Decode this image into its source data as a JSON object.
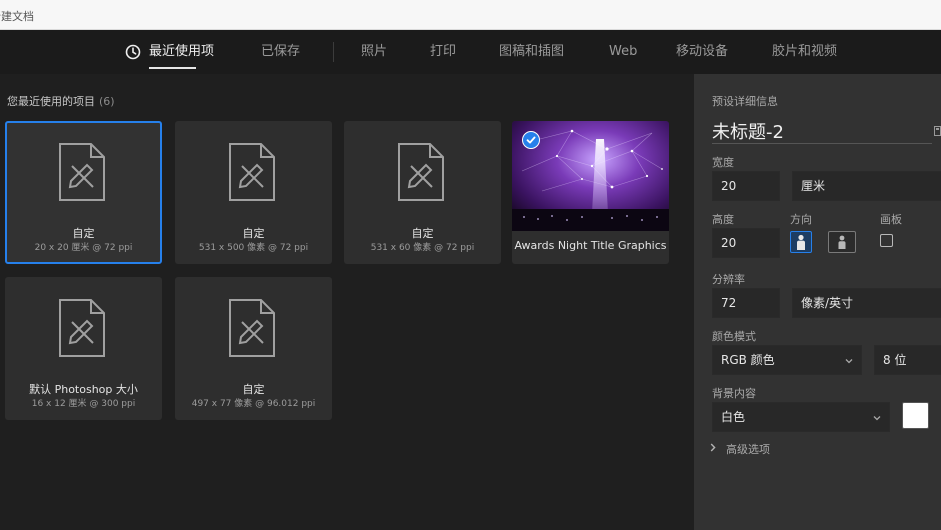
{
  "window": {
    "title": "新建文档"
  },
  "tabs": [
    {
      "label": "最近使用项",
      "active": true,
      "icon": "clock-icon"
    },
    {
      "label": "已保存"
    },
    {
      "label": "照片"
    },
    {
      "label": "打印"
    },
    {
      "label": "图稿和插图"
    },
    {
      "label": "Web"
    },
    {
      "label": "移动设备"
    },
    {
      "label": "胶片和视频"
    }
  ],
  "recent": {
    "title": "您最近使用的项目",
    "count": "(6)",
    "items": [
      {
        "label": "自定",
        "detail": "20 x 20 厘米 @ 72 ppi",
        "selected": true
      },
      {
        "label": "自定",
        "detail": "531 x 500 像素 @ 72 ppi"
      },
      {
        "label": "自定",
        "detail": "531 x 60 像素 @ 72 ppi"
      },
      {
        "label": "Awards Night Title Graphics",
        "template": true,
        "checked": true
      },
      {
        "label": "默认 Photoshop 大小",
        "detail": "16 x 12 厘米 @ 300 ppi"
      },
      {
        "label": "自定",
        "detail": "497 x 77 像素 @ 96.012 ppi"
      }
    ]
  },
  "preset": {
    "section_label": "预设详细信息",
    "name": "未标题-2",
    "width": {
      "label": "宽度",
      "value": "20",
      "unit": "厘米"
    },
    "height": {
      "label": "高度",
      "value": "20"
    },
    "orientation": {
      "label": "方向",
      "options": [
        "portrait",
        "landscape"
      ],
      "selected": "portrait"
    },
    "artboard": {
      "label": "画板",
      "checked": false
    },
    "resolution": {
      "label": "分辨率",
      "value": "72",
      "unit": "像素/英寸"
    },
    "color_mode": {
      "label": "颜色模式",
      "value": "RGB 颜色",
      "depth": "8 位"
    },
    "background": {
      "label": "背景内容",
      "value": "白色",
      "swatch_color": "#ffffff"
    },
    "advanced": {
      "label": "高级选项"
    }
  },
  "colors": {
    "accent": "#2680eb",
    "panel": "#323232",
    "background": "#1f1f1f"
  }
}
